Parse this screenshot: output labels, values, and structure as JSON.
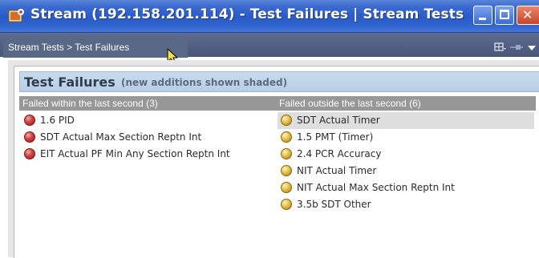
{
  "window": {
    "title_prefix": "Stream (192.158.201.11",
    "title_suffix": "4) - Test Failures | Stream Tests",
    "buttons": {
      "minimize": "minimize",
      "maximize": "maximize",
      "close": "✕"
    }
  },
  "breadcrumb": {
    "text": "Stream Tests > Test Failures"
  },
  "panel": {
    "title": "Test Failures",
    "subtitle": "(new additions shown shaded)"
  },
  "columns": {
    "left": {
      "header": "Failed within the last second (3)",
      "items": [
        {
          "label": "1.6 PID",
          "status": "red",
          "shaded": false
        },
        {
          "label": "SDT Actual Max Section Reptn Int",
          "status": "red",
          "shaded": false
        },
        {
          "label": "EIT Actual PF Min Any Section Reptn Int",
          "status": "red",
          "shaded": false
        }
      ]
    },
    "right": {
      "header": "Failed outside the last second (6)",
      "items": [
        {
          "label": "SDT Actual Timer",
          "status": "yellow",
          "shaded": true
        },
        {
          "label": "1.5 PMT (Timer)",
          "status": "yellow",
          "shaded": false
        },
        {
          "label": "2.4 PCR Accuracy",
          "status": "yellow",
          "shaded": false
        },
        {
          "label": "NIT Actual Timer",
          "status": "yellow",
          "shaded": false
        },
        {
          "label": "NIT Actual Max Section Reptn Int",
          "status": "yellow",
          "shaded": false
        },
        {
          "label": "3.5b SDT Other",
          "status": "yellow",
          "shaded": false
        }
      ]
    }
  },
  "colors": {
    "titlebar": "#3063cf",
    "navbar": "#505d80",
    "red_status": "#d04040",
    "yellow_status": "#e5c04a",
    "column_header": "#979797",
    "shaded_row": "#dedede"
  },
  "icons": {
    "app": "stream-app-icon",
    "cursor": "mouse-pointer-icon",
    "toolbar": [
      "grid-icon",
      "pin-icon",
      "chevron-down-icon"
    ]
  }
}
